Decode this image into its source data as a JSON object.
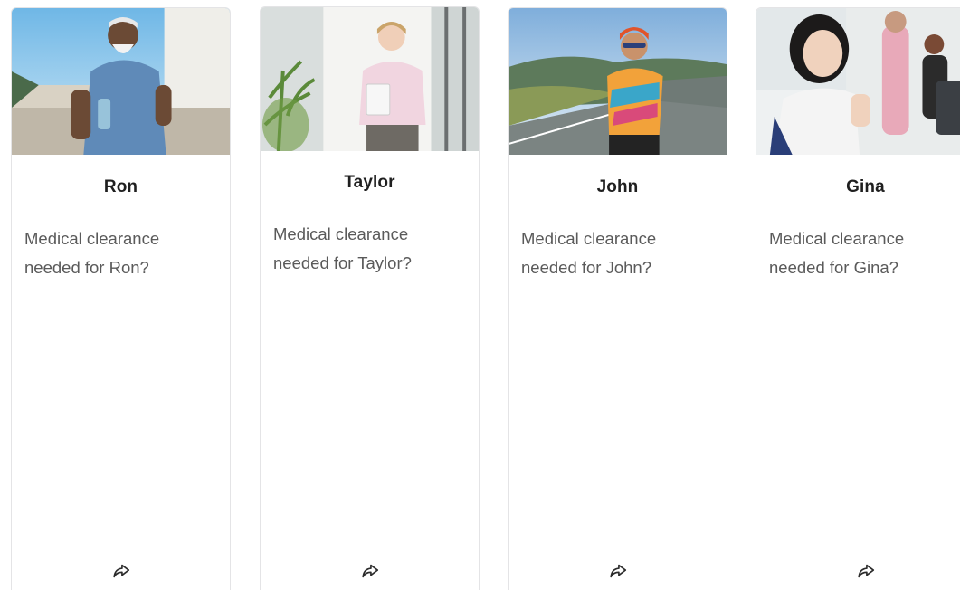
{
  "cards": [
    {
      "name": "Ron",
      "question": "Medical clearance needed for Ron?",
      "photo_icon": "person-walking-photo",
      "share_icon": "share-arrow-icon"
    },
    {
      "name": "Taylor",
      "question": "Medical clearance needed for Taylor?",
      "photo_icon": "person-office-photo",
      "share_icon": "share-arrow-icon"
    },
    {
      "name": "John",
      "question": "Medical clearance needed for John?",
      "photo_icon": "person-cycling-photo",
      "share_icon": "share-arrow-icon"
    },
    {
      "name": "Gina",
      "question": "Medical clearance needed for Gina?",
      "photo_icon": "person-gym-photo",
      "share_icon": "share-arrow-icon"
    }
  ],
  "colors": {
    "card_border": "#e4e4e6",
    "name_text": "#1f1f1f",
    "body_text": "#5a5a5a"
  }
}
